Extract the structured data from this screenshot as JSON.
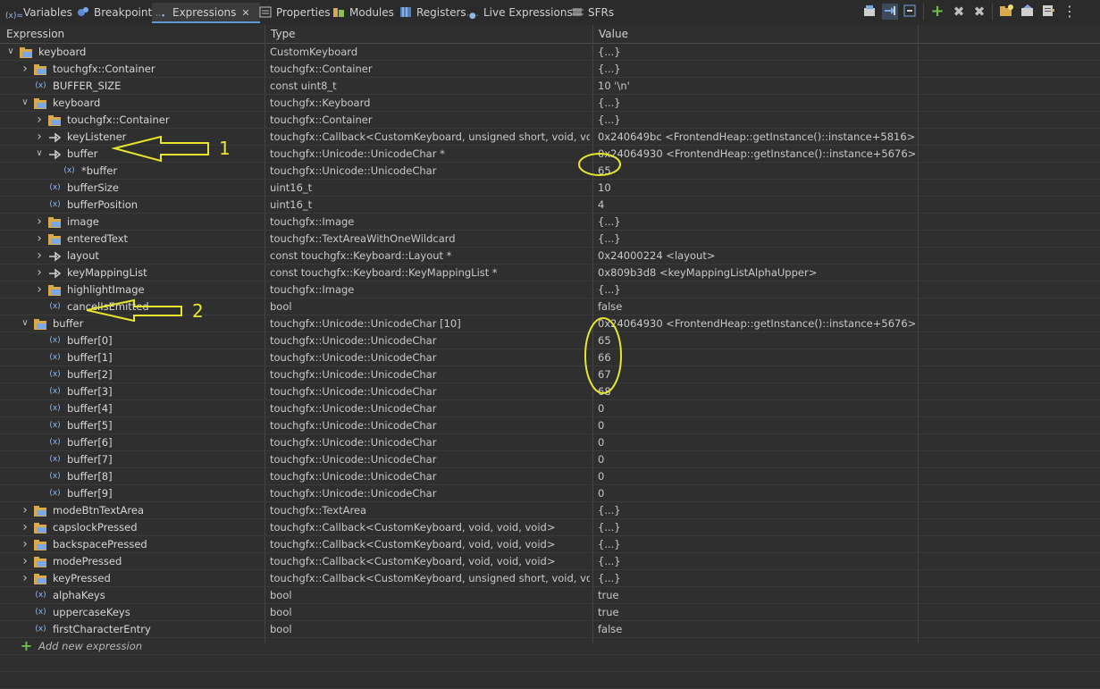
{
  "tabs": [
    {
      "label": "Variables",
      "icon": "variables-icon"
    },
    {
      "label": "Breakpoints",
      "icon": "breakpoints-icon"
    },
    {
      "label": "Expressions",
      "icon": "expressions-icon",
      "active": true
    },
    {
      "label": "Properties",
      "icon": "properties-icon"
    },
    {
      "label": "Modules",
      "icon": "modules-icon"
    },
    {
      "label": "Registers",
      "icon": "registers-icon"
    },
    {
      "label": "Live Expressions",
      "icon": "live-expressions-icon"
    },
    {
      "label": "SFRs",
      "icon": "sfrs-icon"
    }
  ],
  "columns": {
    "expression": "Expression",
    "type": "Type",
    "value": "Value"
  },
  "rows": [
    {
      "depth": 0,
      "tw": "open",
      "icon": "folder",
      "name": "keyboard",
      "type": "CustomKeyboard",
      "value": "{...}"
    },
    {
      "depth": 1,
      "tw": "closed",
      "icon": "folder",
      "name": "touchgfx::Container",
      "type": "touchgfx::Container",
      "value": "{...}"
    },
    {
      "depth": 1,
      "tw": "none",
      "icon": "var",
      "name": "BUFFER_SIZE",
      "type": "const uint8_t",
      "value": "10 '\\n'"
    },
    {
      "depth": 1,
      "tw": "open",
      "icon": "folder",
      "name": "keyboard",
      "type": "touchgfx::Keyboard",
      "value": "{...}"
    },
    {
      "depth": 2,
      "tw": "closed",
      "icon": "folder",
      "name": "touchgfx::Container",
      "type": "touchgfx::Container",
      "value": "{...}"
    },
    {
      "depth": 2,
      "tw": "closed",
      "icon": "pointer",
      "name": "keyListener",
      "type": "touchgfx::Callback<CustomKeyboard, unsigned short, void, void> *",
      "value": "0x240649bc <FrontendHeap::getInstance()::instance+5816>"
    },
    {
      "depth": 2,
      "tw": "open",
      "icon": "pointer",
      "name": "buffer",
      "type": "touchgfx::Unicode::UnicodeChar *",
      "value": "0x24064930 <FrontendHeap::getInstance()::instance+5676>"
    },
    {
      "depth": 3,
      "tw": "none",
      "icon": "var",
      "name": "*buffer",
      "type": "touchgfx::Unicode::UnicodeChar",
      "value": "65"
    },
    {
      "depth": 2,
      "tw": "none",
      "icon": "var",
      "name": "bufferSize",
      "type": "uint16_t",
      "value": "10"
    },
    {
      "depth": 2,
      "tw": "none",
      "icon": "var",
      "name": "bufferPosition",
      "type": "uint16_t",
      "value": "4"
    },
    {
      "depth": 2,
      "tw": "closed",
      "icon": "folder",
      "name": "image",
      "type": "touchgfx::Image",
      "value": "{...}"
    },
    {
      "depth": 2,
      "tw": "closed",
      "icon": "folder",
      "name": "enteredText",
      "type": "touchgfx::TextAreaWithOneWildcard",
      "value": "{...}"
    },
    {
      "depth": 2,
      "tw": "closed",
      "icon": "pointer",
      "name": "layout",
      "type": "const touchgfx::Keyboard::Layout *",
      "value": "0x24000224 <layout>"
    },
    {
      "depth": 2,
      "tw": "closed",
      "icon": "pointer",
      "name": "keyMappingList",
      "type": "const touchgfx::Keyboard::KeyMappingList *",
      "value": "0x809b3d8 <keyMappingListAlphaUpper>"
    },
    {
      "depth": 2,
      "tw": "closed",
      "icon": "folder",
      "name": "highlightImage",
      "type": "touchgfx::Image",
      "value": "{...}"
    },
    {
      "depth": 2,
      "tw": "none",
      "icon": "var",
      "name": "cancelIsEmitted",
      "type": "bool",
      "value": "false"
    },
    {
      "depth": 1,
      "tw": "open",
      "icon": "folder",
      "name": "buffer",
      "type": "touchgfx::Unicode::UnicodeChar [10]",
      "value": "0x24064930 <FrontendHeap::getInstance()::instance+5676>"
    },
    {
      "depth": 2,
      "tw": "none",
      "icon": "var",
      "name": "buffer[0]",
      "type": "touchgfx::Unicode::UnicodeChar",
      "value": "65"
    },
    {
      "depth": 2,
      "tw": "none",
      "icon": "var",
      "name": "buffer[1]",
      "type": "touchgfx::Unicode::UnicodeChar",
      "value": "66"
    },
    {
      "depth": 2,
      "tw": "none",
      "icon": "var",
      "name": "buffer[2]",
      "type": "touchgfx::Unicode::UnicodeChar",
      "value": "67"
    },
    {
      "depth": 2,
      "tw": "none",
      "icon": "var",
      "name": "buffer[3]",
      "type": "touchgfx::Unicode::UnicodeChar",
      "value": "68"
    },
    {
      "depth": 2,
      "tw": "none",
      "icon": "var",
      "name": "buffer[4]",
      "type": "touchgfx::Unicode::UnicodeChar",
      "value": "0"
    },
    {
      "depth": 2,
      "tw": "none",
      "icon": "var",
      "name": "buffer[5]",
      "type": "touchgfx::Unicode::UnicodeChar",
      "value": "0"
    },
    {
      "depth": 2,
      "tw": "none",
      "icon": "var",
      "name": "buffer[6]",
      "type": "touchgfx::Unicode::UnicodeChar",
      "value": "0"
    },
    {
      "depth": 2,
      "tw": "none",
      "icon": "var",
      "name": "buffer[7]",
      "type": "touchgfx::Unicode::UnicodeChar",
      "value": "0"
    },
    {
      "depth": 2,
      "tw": "none",
      "icon": "var",
      "name": "buffer[8]",
      "type": "touchgfx::Unicode::UnicodeChar",
      "value": "0"
    },
    {
      "depth": 2,
      "tw": "none",
      "icon": "var",
      "name": "buffer[9]",
      "type": "touchgfx::Unicode::UnicodeChar",
      "value": "0"
    },
    {
      "depth": 1,
      "tw": "closed",
      "icon": "folder",
      "name": "modeBtnTextArea",
      "type": "touchgfx::TextArea",
      "value": "{...}"
    },
    {
      "depth": 1,
      "tw": "closed",
      "icon": "folder",
      "name": "capslockPressed",
      "type": "touchgfx::Callback<CustomKeyboard, void, void, void>",
      "value": "{...}"
    },
    {
      "depth": 1,
      "tw": "closed",
      "icon": "folder",
      "name": "backspacePressed",
      "type": "touchgfx::Callback<CustomKeyboard, void, void, void>",
      "value": "{...}"
    },
    {
      "depth": 1,
      "tw": "closed",
      "icon": "folder",
      "name": "modePressed",
      "type": "touchgfx::Callback<CustomKeyboard, void, void, void>",
      "value": "{...}"
    },
    {
      "depth": 1,
      "tw": "closed",
      "icon": "folder",
      "name": "keyPressed",
      "type": "touchgfx::Callback<CustomKeyboard, unsigned short, void, void>",
      "value": "{...}"
    },
    {
      "depth": 1,
      "tw": "none",
      "icon": "var",
      "name": "alphaKeys",
      "type": "bool",
      "value": "true"
    },
    {
      "depth": 1,
      "tw": "none",
      "icon": "var",
      "name": "uppercaseKeys",
      "type": "bool",
      "value": "true"
    },
    {
      "depth": 1,
      "tw": "none",
      "icon": "var",
      "name": "firstCharacterEntry",
      "type": "bool",
      "value": "false"
    }
  ],
  "add_expression": "Add new expression",
  "annotations": {
    "arrow1_label": "1",
    "arrow2_label": "2"
  },
  "colors": {
    "accent": "#5e9bd6",
    "annotation": "#e8e52c",
    "folder": "#d9a94a"
  }
}
